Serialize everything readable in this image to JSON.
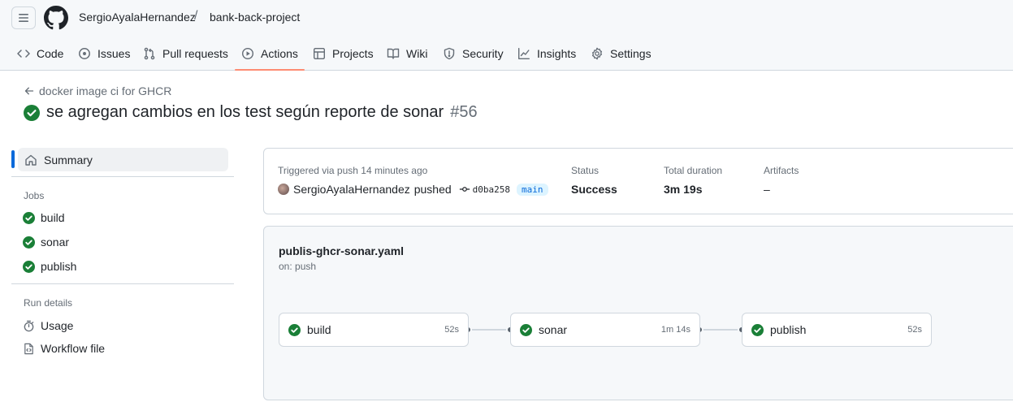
{
  "header": {
    "owner": "SergioAyalaHernandez",
    "separator": "/",
    "repo": "bank-back-project"
  },
  "tabs": [
    {
      "label": "Code",
      "icon": "code-icon"
    },
    {
      "label": "Issues",
      "icon": "issue-icon"
    },
    {
      "label": "Pull requests",
      "icon": "pull-request-icon"
    },
    {
      "label": "Actions",
      "icon": "play-icon",
      "active": true
    },
    {
      "label": "Projects",
      "icon": "table-icon"
    },
    {
      "label": "Wiki",
      "icon": "book-icon"
    },
    {
      "label": "Security",
      "icon": "shield-icon"
    },
    {
      "label": "Insights",
      "icon": "graph-icon"
    },
    {
      "label": "Settings",
      "icon": "gear-icon"
    }
  ],
  "run": {
    "back_link": "docker image ci for GHCR",
    "title": "se agregan cambios en los test según reporte de sonar",
    "number": "#56"
  },
  "sidebar": {
    "summary": "Summary",
    "jobs_heading": "Jobs",
    "jobs": [
      "build",
      "sonar",
      "publish"
    ],
    "run_details_heading": "Run details",
    "usage": "Usage",
    "workflow_file": "Workflow file"
  },
  "summary_card": {
    "trigger_label": "Triggered via push 14 minutes ago",
    "actor": "SergioAyalaHernandez",
    "action": "pushed",
    "commit": "d0ba258",
    "branch": "main",
    "status_label": "Status",
    "status_value": "Success",
    "duration_label": "Total duration",
    "duration_value": "3m 19s",
    "artifacts_label": "Artifacts",
    "artifacts_value": "–"
  },
  "workflow": {
    "file": "publis-ghcr-sonar.yaml",
    "trigger": "on: push",
    "jobs": [
      {
        "name": "build",
        "duration": "52s"
      },
      {
        "name": "sonar",
        "duration": "1m 14s"
      },
      {
        "name": "publish",
        "duration": "52s"
      }
    ]
  },
  "colors": {
    "success": "#1a7f37",
    "accent": "#0969da",
    "active_tab_underline": "#fd8c73"
  }
}
